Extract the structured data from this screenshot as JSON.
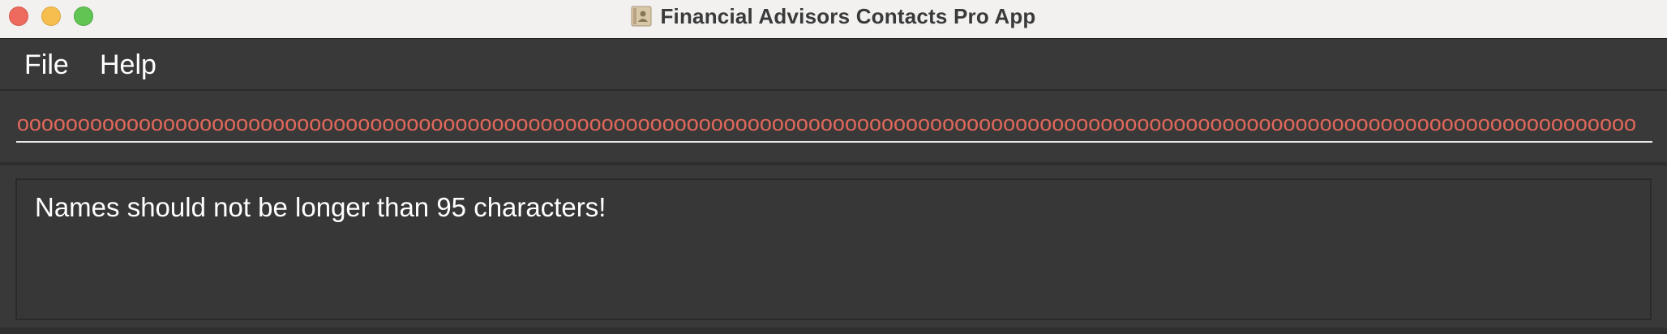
{
  "window": {
    "title": "Financial Advisors Contacts Pro App"
  },
  "menu": {
    "items": [
      {
        "label": "File"
      },
      {
        "label": "Help"
      }
    ]
  },
  "command_box": {
    "value": "oooooooooooooooooooooooooooooooooooooooooooooooooooooooooooooooooooooooooooooooooooooooooooooooooooooooooooooooooooooooooooooooooooooooooooo",
    "text_color": "#e0685b"
  },
  "result_display": {
    "message": "Names should not be longer than 95 characters!"
  },
  "colors": {
    "titlebar_bg": "#f2f1f0",
    "app_bg": "#393939",
    "error_text": "#e0685b",
    "close": "#ee6a5e",
    "minimize": "#f5be4f",
    "zoom": "#61c554"
  }
}
